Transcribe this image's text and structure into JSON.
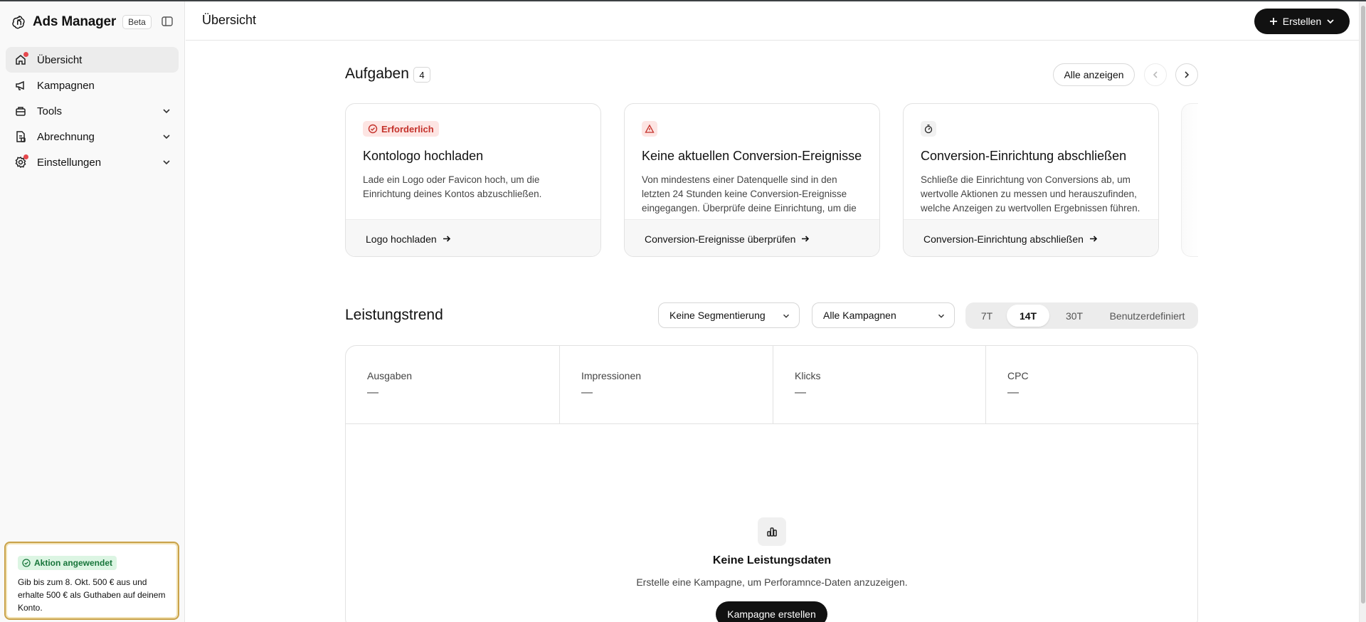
{
  "sidebar": {
    "app_name": "Ads Manager",
    "beta_label": "Beta",
    "items": [
      {
        "label": "Übersicht",
        "icon": "home-icon",
        "active": true,
        "notification_dot": true
      },
      {
        "label": "Kampagnen",
        "icon": "megaphone-icon"
      },
      {
        "label": "Tools",
        "icon": "toolbox-icon",
        "expandable": true
      },
      {
        "label": "Abrechnung",
        "icon": "receipt-icon",
        "expandable": true
      },
      {
        "label": "Einstellungen",
        "icon": "gear-icon",
        "expandable": true,
        "notification_dot": true
      }
    ],
    "promo": {
      "badge": "Aktion angewendet",
      "text": "Gib bis zum 8. Okt. 500 € aus und erhalte 500 € als Guthaben auf deinem Konto."
    }
  },
  "header": {
    "title": "Übersicht",
    "create_label": "Erstellen"
  },
  "tasks": {
    "title": "Aufgaben",
    "count": "4",
    "show_all_label": "Alle anzeigen",
    "cards": [
      {
        "badge": "Erforderlich",
        "badge_icon": "check-circle-icon",
        "title": "Kontologo hochladen",
        "description": "Lade ein Logo oder Favicon hoch, um die Einrichtung deines Kontos abzuschließen.",
        "action": "Logo hochladen"
      },
      {
        "badge_icon": "warning-triangle-icon",
        "title": "Keine aktuellen Conversion-Ereignisse",
        "description": "Von mindestens einer Datenquelle sind in den letzten 24 Stunden keine Conversion-Ereignisse eingegangen. Überprüfe deine Einrichtung, um die Messung sicherzustellen.",
        "action": "Conversion-Ereignisse überprüfen"
      },
      {
        "badge_icon": "timer-icon",
        "title": "Conversion-Einrichtung abschließen",
        "description": "Schließe die Einrichtung von Conversions ab, um wertvolle Aktionen zu messen und herauszufinden, welche Anzeigen zu wertvollen Ergebnissen führen.",
        "action": "Conversion-Einrichtung abschließen"
      }
    ]
  },
  "trend": {
    "title": "Leistungstrend",
    "segmentation_select": "Keine Segmentierung",
    "campaign_select": "Alle Kampagnen",
    "ranges": [
      "7T",
      "14T",
      "30T",
      "Benutzerdefiniert"
    ],
    "selected_range": "14T",
    "metrics": [
      {
        "label": "Ausgaben",
        "value": "—"
      },
      {
        "label": "Impressionen",
        "value": "—"
      },
      {
        "label": "Klicks",
        "value": "—"
      },
      {
        "label": "CPC",
        "value": "—"
      }
    ],
    "empty": {
      "title": "Keine Leistungsdaten",
      "text": "Erstelle eine Kampagne, um Perforamnce-Daten anzuzeigen.",
      "button": "Kampagne erstellen"
    }
  }
}
